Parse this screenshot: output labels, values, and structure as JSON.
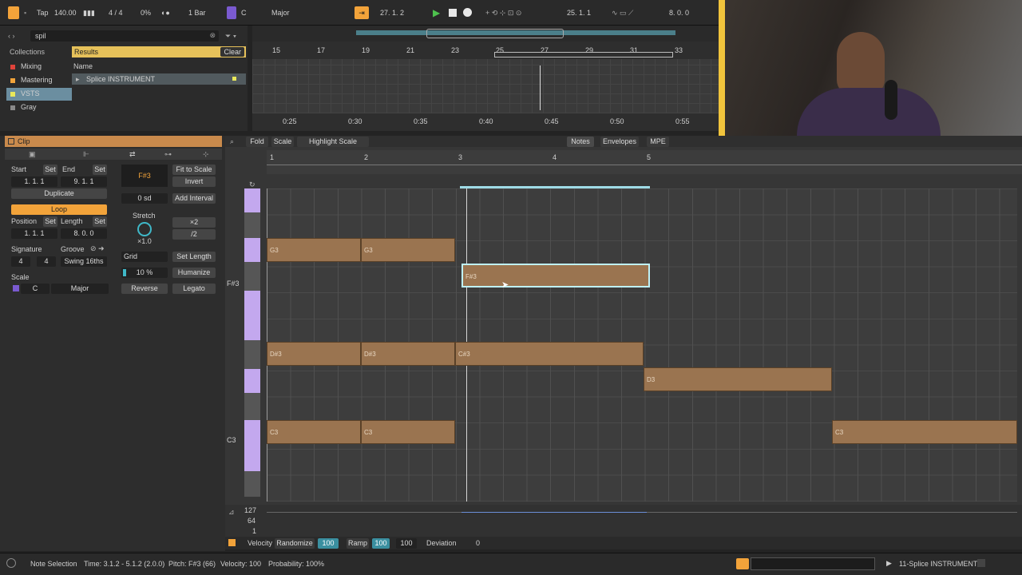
{
  "transport": {
    "tap": "Tap",
    "tempo": "140.00",
    "signature": "4 / 4",
    "swing": "0%",
    "quantize": "1 Bar",
    "key": "C",
    "scale_mode": "Major",
    "position": "27. 1. 2",
    "loop_start": "25. 1. 1",
    "loop_length": "8. 0. 0"
  },
  "browser": {
    "search_value": "spil",
    "collections_header": "Collections",
    "collections": [
      {
        "label": "Mixing",
        "color": "#e0433a"
      },
      {
        "label": "Mastering",
        "color": "#f2a33a"
      },
      {
        "label": "VSTS",
        "color": "#e8e85a"
      },
      {
        "label": "Gray",
        "color": "#8a8a8a"
      }
    ],
    "results_label": "Results",
    "clear_label": "Clear",
    "name_header": "Name",
    "result_item": "Splice INSTRUMENT"
  },
  "arrangement": {
    "bar_ticks": [
      "15",
      "17",
      "19",
      "21",
      "23",
      "25",
      "27",
      "29",
      "31",
      "33"
    ],
    "time_ticks": [
      "0:25",
      "0:30",
      "0:35",
      "0:40",
      "0:45",
      "0:50",
      "0:55"
    ]
  },
  "clip": {
    "title": "Clip",
    "start_label": "Start",
    "end_label": "End",
    "set_label": "Set",
    "start_value": "1.  1.  1",
    "end_value": "9.  1.  1",
    "duplicate_label": "Duplicate",
    "loop_label": "Loop",
    "position_label": "Position",
    "length_label": "Length",
    "position_value": "1.  1.  1",
    "length_value": "8.  0.  0",
    "signature_label": "Signature",
    "groove_label": "Groove",
    "sig_num": "4",
    "sig_den": "4",
    "groove_value": "Swing 16ths",
    "scale_label": "Scale",
    "scale_root": "C",
    "scale_mode": "Major",
    "pitch_value": "F#3",
    "fit_to_scale": "Fit to Scale",
    "invert": "Invert",
    "sd_value": "0 sd",
    "add_interval": "Add Interval",
    "stretch_label": "Stretch",
    "stretch_value": "×1.0",
    "x2": "×2",
    "div2": "/2",
    "grid_label": "Grid",
    "set_length": "Set Length",
    "humanize_amount": "10 %",
    "humanize": "Humanize",
    "reverse": "Reverse",
    "legato": "Legato"
  },
  "editor": {
    "fold": "Fold",
    "scale": "Scale",
    "highlight_scale": "Highlight Scale",
    "tabs": [
      "Notes",
      "Envelopes",
      "MPE"
    ],
    "bar_numbers": [
      "1",
      "2",
      "3",
      "4",
      "5"
    ],
    "key_f3": "F#3",
    "key_c3": "C3",
    "notes": [
      {
        "pitch": "G3",
        "start": 1,
        "len": 1
      },
      {
        "pitch": "G3",
        "start": 2,
        "len": 1
      },
      {
        "pitch": "F#3",
        "start": 3,
        "len": 2
      },
      {
        "pitch": "D#3",
        "start": 1,
        "len": 1
      },
      {
        "pitch": "D#3",
        "start": 2,
        "len": 1
      },
      {
        "pitch": "C#3",
        "start": 3,
        "len": 2
      },
      {
        "pitch": "D3",
        "start": 5,
        "len": 2
      },
      {
        "pitch": "C3",
        "start": 1,
        "len": 1
      },
      {
        "pitch": "C3",
        "start": 2,
        "len": 1
      },
      {
        "pitch": "C3",
        "start": 7,
        "len": 2
      }
    ],
    "vel_127": "127",
    "vel_64": "64",
    "vel_1": "1",
    "velocity": "Velocity",
    "randomize": "Randomize",
    "rand_value": "100",
    "ramp": "Ramp",
    "ramp_value_a": "100",
    "ramp_value_b": "100",
    "deviation": "Deviation",
    "deviation_value": "0"
  },
  "status": {
    "selection": "Note Selection",
    "time": "Time: 3.1.2 - 5.1.2 (2.0.0)",
    "pitch": "Pitch: F#3 (66)",
    "velocity": "Velocity: 100",
    "probability": "Probability: 100%",
    "track": "11-Splice INSTRUMENT"
  }
}
